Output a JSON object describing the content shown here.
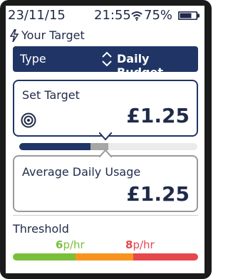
{
  "status": {
    "date": "23/11/15",
    "time": "21:55",
    "battery_text": "75%",
    "wifi_icon": "wifi-icon",
    "battery_icon": "battery-icon"
  },
  "header": {
    "title": "Your Target",
    "icon": "lightning-bolt-icon"
  },
  "type_selector": {
    "label": "Type",
    "value": "Daily Budget",
    "icon": "up-down-arrows-icon"
  },
  "target": {
    "label": "Set Target",
    "amount": "£1.25",
    "icon": "target-icon"
  },
  "progress": {
    "fill_fraction": 0.4,
    "marker_fraction": 0.5
  },
  "usage": {
    "label": "Average Daily Usage",
    "amount": "£1.25"
  },
  "threshold": {
    "title": "Threshold",
    "low_value": "6",
    "low_unit": "p/hr",
    "high_value": "8",
    "high_unit": "p/hr",
    "segments": [
      {
        "color": "#7abf3b",
        "fraction": 0.34
      },
      {
        "color": "#f7941d",
        "fraction": 0.31
      },
      {
        "color": "#e5484d",
        "fraction": 0.35
      }
    ]
  },
  "colors": {
    "primary": "#203565",
    "text": "#1f2a4a",
    "low": "#7abf3b",
    "mid": "#f7941d",
    "high": "#e5484d"
  }
}
